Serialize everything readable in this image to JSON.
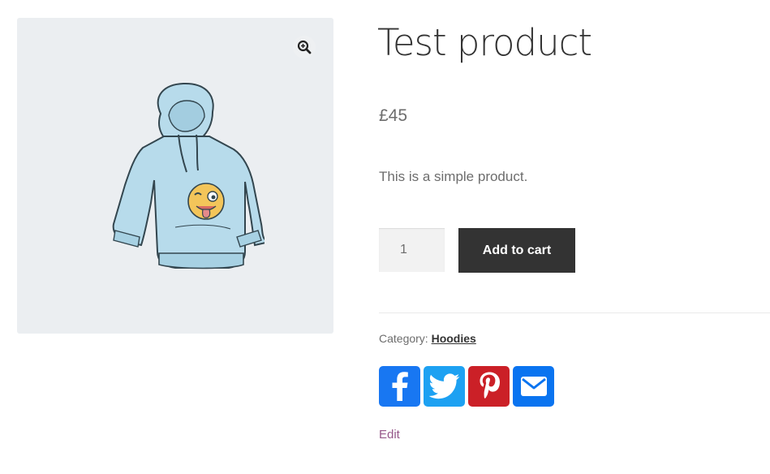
{
  "product": {
    "title": "Test product",
    "price": "£45",
    "description": "This is a simple product.",
    "quantity": "1",
    "add_to_cart_label": "Add to cart",
    "category_label": "Category:",
    "category_value": "Hoodies",
    "edit_label": "Edit"
  },
  "gallery": {
    "background": "#ebeef1",
    "zoom_icon": "zoom-in-icon",
    "image_name": "hoodie-with-winking-emoji"
  },
  "share": [
    {
      "name": "facebook",
      "icon": "facebook-icon",
      "color": "#1877f2"
    },
    {
      "name": "twitter",
      "icon": "twitter-icon",
      "color": "#1da1f2"
    },
    {
      "name": "pinterest",
      "icon": "pinterest-icon",
      "color": "#cb2027"
    },
    {
      "name": "email",
      "icon": "email-icon",
      "color": "#0a74f0"
    }
  ],
  "colors": {
    "button": "#333333",
    "edit_link": "#96588a"
  }
}
